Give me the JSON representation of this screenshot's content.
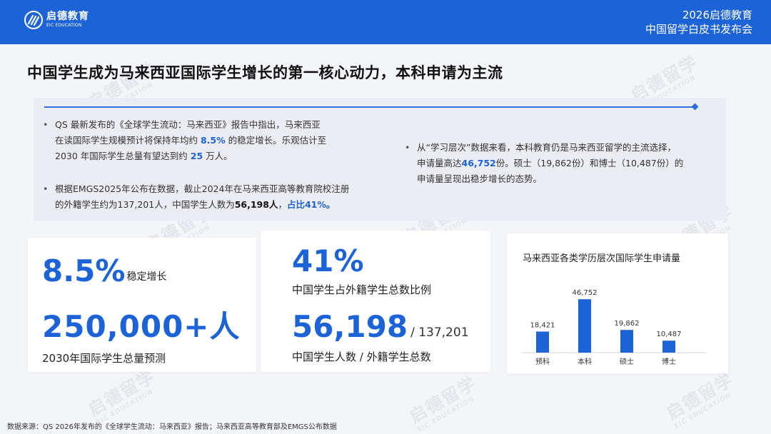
{
  "header": {
    "brand_cn": "启德教育",
    "brand_en": "EIC EDUCATION",
    "event_line1": "2026启德教育",
    "event_line2": "中国留学白皮书发布会",
    "bg_color": "#1d63d8"
  },
  "watermark": {
    "cn": "启德留学",
    "en": "EIC EDUCATION"
  },
  "page_title": "中国学生成为马来西亚国际学生增长的第一核心动力，本科申请为主流",
  "bullets": {
    "b1_line1": "QS 最新发布的《全球学生流动：马来西亚》报告中指出，马来西亚",
    "b1_line2_pre": "在读国际学生规模预计将保持年均约 ",
    "b1_line2_hl": "8.5%",
    "b1_line2_post": " 的稳定增长。乐观估计至",
    "b1_line3_pre": "2030 年国际学生总量有望达到约 ",
    "b1_line3_hl": "25",
    "b1_line3_post": " 万人。",
    "b2_line1": "根据EMGS2025年公布在数据，截止2024年在马来西亚高等教育院校注册",
    "b2_line2_pre": "的外籍学生约为137,201人，中国学生人数为",
    "b2_line2_b": "56,198人",
    "b2_line2_sep": "，",
    "b2_line2_hl": "占比41%。",
    "b3_line1": "从“学习层次”数据来看，本科教育仍是马来西亚留学的主流选择，",
    "b3_line2_pre": "申请量高达",
    "b3_line2_hl": "46,752",
    "b3_line2_post": "份。硕士（19,862份）和博士（10,487份）的",
    "b3_line3": "申请量呈现出稳步增长的态势。"
  },
  "stats": {
    "growth_value": "8.5%",
    "growth_label": "稳定增长",
    "total_value": "250,000+人",
    "total_label": "2030年国际学生总量预测",
    "share_value": "41%",
    "share_label": "中国学生占外籍学生总数比例",
    "count_value": "56,198",
    "count_total": "/ 137,201",
    "count_label": "中国学生人数 / 外籍学生总数"
  },
  "chart_data": {
    "type": "bar",
    "title": "马来西亚各类学历层次国际学生申请量",
    "categories": [
      "预科",
      "本科",
      "硕士",
      "博士"
    ],
    "values": [
      18421,
      46752,
      19862,
      10487
    ],
    "value_labels": [
      "18,421",
      "46,752",
      "19,862",
      "10,487"
    ],
    "ylim": [
      0,
      50000
    ],
    "bar_color": "#1d63d8",
    "grid": false,
    "legend": "none"
  },
  "footer": "数据来源：QS 2026年发布的《全球学生流动：马来西亚》报告；马来西亚高等教育部及EMGS公布数据"
}
